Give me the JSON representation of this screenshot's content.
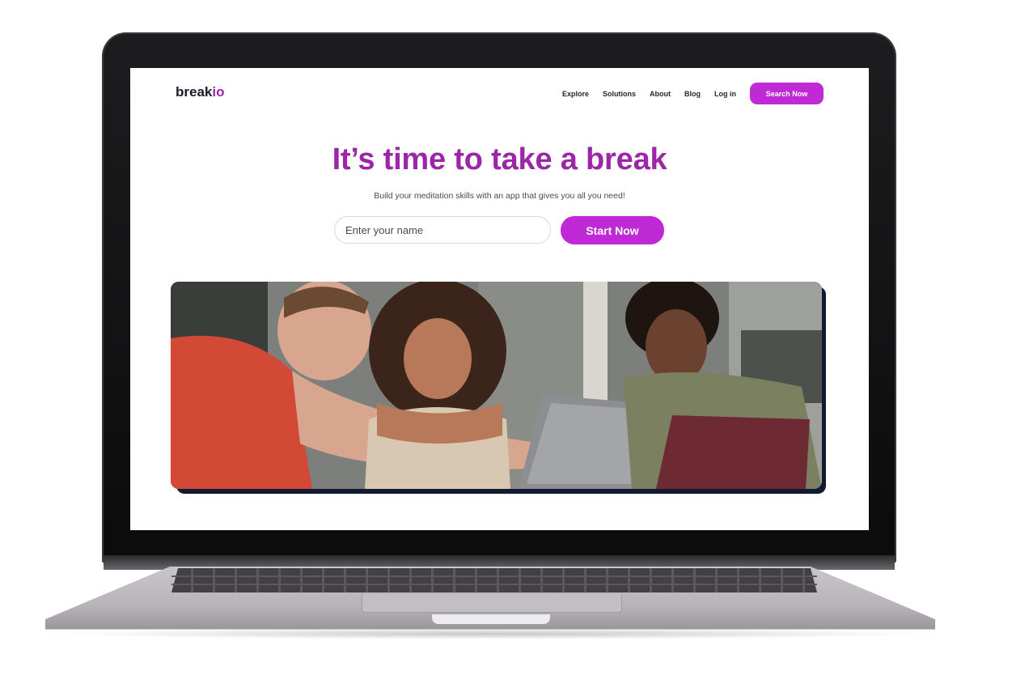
{
  "site": {
    "logo_main": "break",
    "logo_accent": "io",
    "nav": {
      "links": [
        "Explore",
        "Solutions",
        "About",
        "Blog",
        "Log in"
      ],
      "cta_label": "Search Now"
    },
    "hero": {
      "headline": "It’s time to take a break",
      "subline": "Build your meditation skills with an app that gives you all you need!",
      "name_placeholder": "Enter your name",
      "start_label": "Start Now"
    }
  },
  "colors": {
    "brand_purple": "#9b27a8",
    "button_magenta": "#bf2ad6",
    "laptop_frame": "#111113",
    "laptop_base": "#bdb9be"
  },
  "icons": {
    "device": "laptop-mockup"
  }
}
